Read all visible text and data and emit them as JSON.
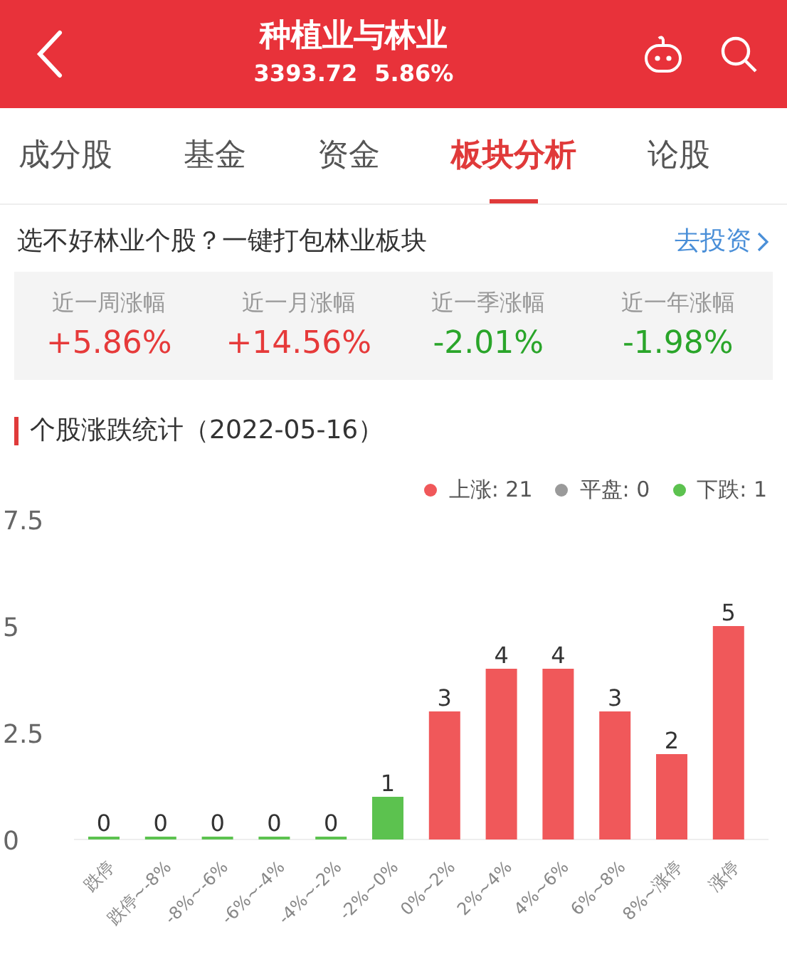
{
  "header": {
    "title": "种植业与林业",
    "price": "3393.72",
    "change": "5.86%"
  },
  "tabs": [
    {
      "label": "成分股",
      "selected": false
    },
    {
      "label": "基金",
      "selected": false
    },
    {
      "label": "资金",
      "selected": false
    },
    {
      "label": "板块分析",
      "selected": true
    },
    {
      "label": "论股",
      "selected": false
    }
  ],
  "promo": {
    "text": "选不好林业个股？一键打包林业板块",
    "link": "去投资"
  },
  "returns": [
    {
      "label": "近一周涨幅",
      "value": "+5.86%",
      "kind": "up"
    },
    {
      "label": "近一月涨幅",
      "value": "+14.56%",
      "kind": "up"
    },
    {
      "label": "近一季涨幅",
      "value": "-2.01%",
      "kind": "down"
    },
    {
      "label": "近一年涨幅",
      "value": "-1.98%",
      "kind": "down"
    }
  ],
  "stats": {
    "title": "个股涨跌统计（2022-05-16）",
    "legend": [
      {
        "label": "上涨: 21",
        "color": "#f0585a"
      },
      {
        "label": "平盘: 0",
        "color": "#9a9a9a"
      },
      {
        "label": "下跌: 1",
        "color": "#5cc24f"
      }
    ],
    "chart_data": {
      "type": "bar",
      "categories": [
        "跌停",
        "跌停~-8%",
        "-8%~-6%",
        "-6%~-4%",
        "-4%~-2%",
        "-2%~0%",
        "0%~2%",
        "2%~4%",
        "4%~6%",
        "6%~8%",
        "8%~涨停",
        "涨停"
      ],
      "series": [
        {
          "color": "#5cc24f",
          "values": [
            0,
            0,
            0,
            0,
            0,
            1,
            null,
            null,
            null,
            null,
            null,
            null
          ]
        },
        {
          "color": "#f0585a",
          "values": [
            null,
            null,
            null,
            null,
            null,
            null,
            3,
            4,
            4,
            3,
            2,
            5
          ]
        }
      ],
      "ylim": [
        0,
        7.5
      ],
      "yticks": [
        0,
        {
          "value": 2.5,
          "label": "2.5"
        },
        5,
        {
          "value": 7.5,
          "label": "7.5"
        }
      ],
      "data_labels": true
    }
  }
}
